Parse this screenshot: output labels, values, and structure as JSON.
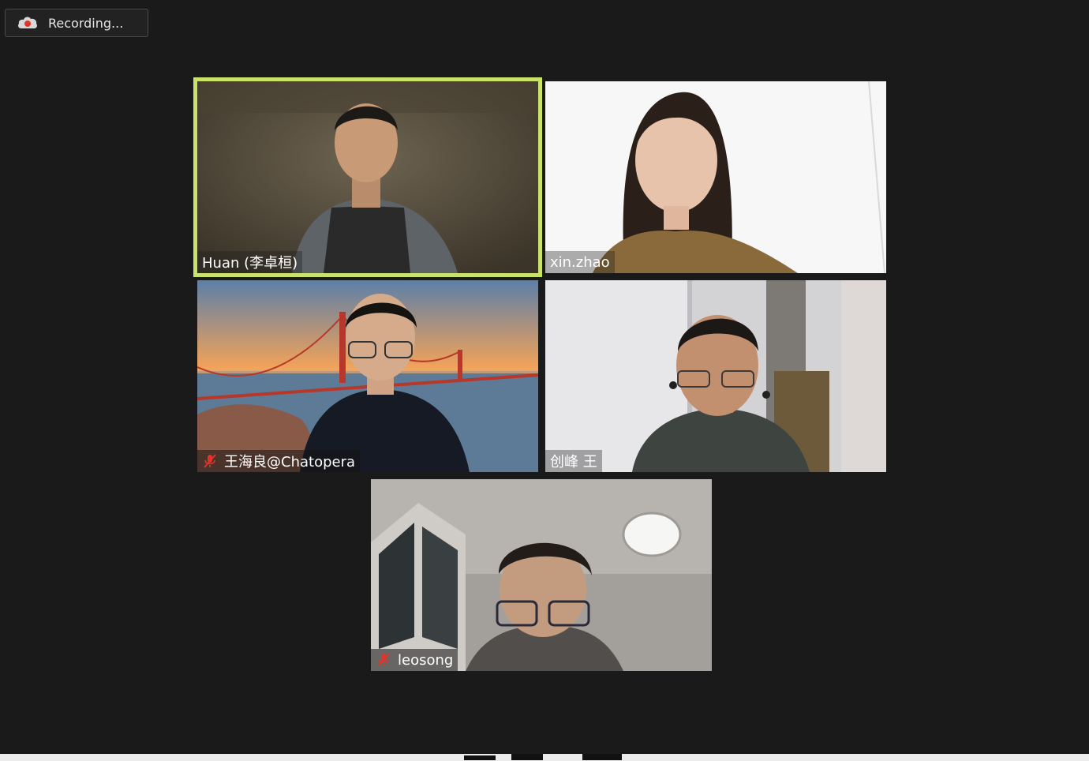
{
  "recording": {
    "label": "Recording...",
    "icon": "cloud-record-icon",
    "dot_color": "#e0342c"
  },
  "tiles": [
    {
      "name": "Huan (李卓桓)",
      "muted": false,
      "active_speaker": true
    },
    {
      "name": "xin.zhao",
      "muted": false,
      "active_speaker": false
    },
    {
      "name": "王海良@Chatopera",
      "muted": true,
      "active_speaker": false
    },
    {
      "name": "创峰 王",
      "muted": false,
      "active_speaker": false
    },
    {
      "name": "leosong",
      "muted": true,
      "active_speaker": false
    }
  ],
  "colors": {
    "background": "#1a1a1a",
    "active_speaker_border": "#c9e26a",
    "muted_icon": "#e0342c"
  },
  "icons": {
    "muted": "microphone-muted-icon"
  }
}
